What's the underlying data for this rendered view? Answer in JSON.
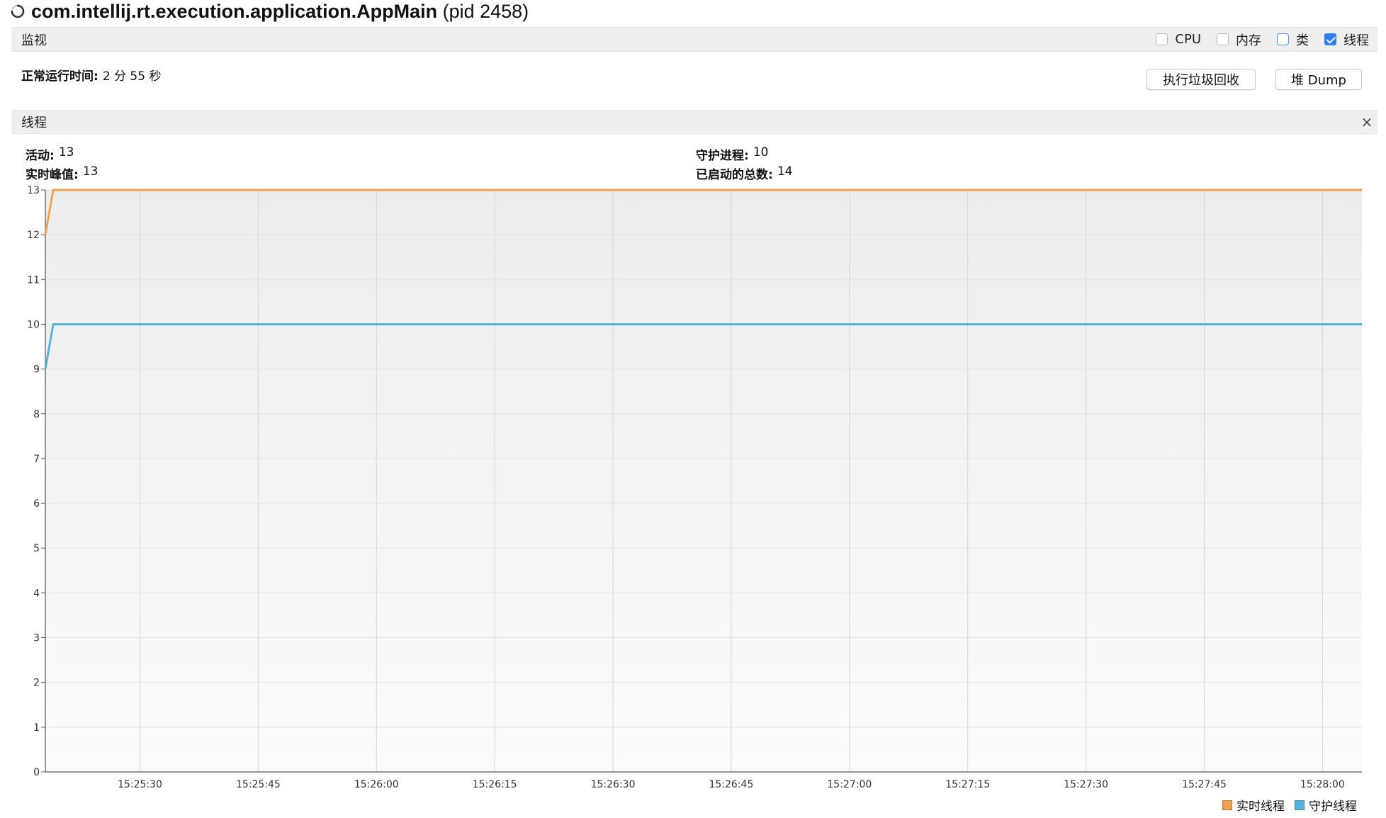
{
  "window": {
    "title_main": "com.intellij.rt.execution.application.AppMain",
    "title_pid": "(pid 2458)"
  },
  "monitor": {
    "label": "监视",
    "checkboxes": [
      {
        "label": "CPU",
        "checked": false
      },
      {
        "label": "内存",
        "checked": false
      },
      {
        "label": "类",
        "checked": false
      },
      {
        "label": "线程",
        "checked": true
      }
    ],
    "uptime_label": "正常运行时间:",
    "uptime_value": "2 分 55 秒",
    "gc_button": "执行垃圾回收",
    "dump_button": "堆 Dump"
  },
  "threads": {
    "label": "线程",
    "close_glyph": "×",
    "live_label": "活动:",
    "live_value": "13",
    "peak_label": "实时峰值:",
    "peak_value": "13",
    "daemon_label": "守护进程:",
    "daemon_value": "10",
    "total_label": "已启动的总数:",
    "total_value": "14"
  },
  "colors": {
    "live": "#f0a24c",
    "daemon": "#56b1dc"
  },
  "chart_data": {
    "type": "line",
    "title": "",
    "xlabel": "",
    "ylabel": "",
    "ylim": [
      0,
      13
    ],
    "yticks": [
      0,
      1,
      2,
      3,
      4,
      5,
      6,
      7,
      8,
      9,
      10,
      11,
      12,
      13
    ],
    "xlim": [
      "15:25:18",
      "15:28:05"
    ],
    "xticks": [
      "15:25:30",
      "15:25:45",
      "15:26:00",
      "15:26:15",
      "15:26:30",
      "15:26:45",
      "15:27:00",
      "15:27:15",
      "15:27:30",
      "15:27:45",
      "15:28:00"
    ],
    "grid": true,
    "legend": "bottom-right",
    "series": [
      {
        "name": "实时线程",
        "color": "#f0a24c",
        "x": [
          "15:25:18",
          "15:25:19",
          "15:28:05"
        ],
        "values": [
          12,
          13,
          13
        ]
      },
      {
        "name": "守护线程",
        "color": "#56b1dc",
        "x": [
          "15:25:18",
          "15:25:19",
          "15:28:05"
        ],
        "values": [
          9,
          10,
          10
        ]
      }
    ]
  }
}
